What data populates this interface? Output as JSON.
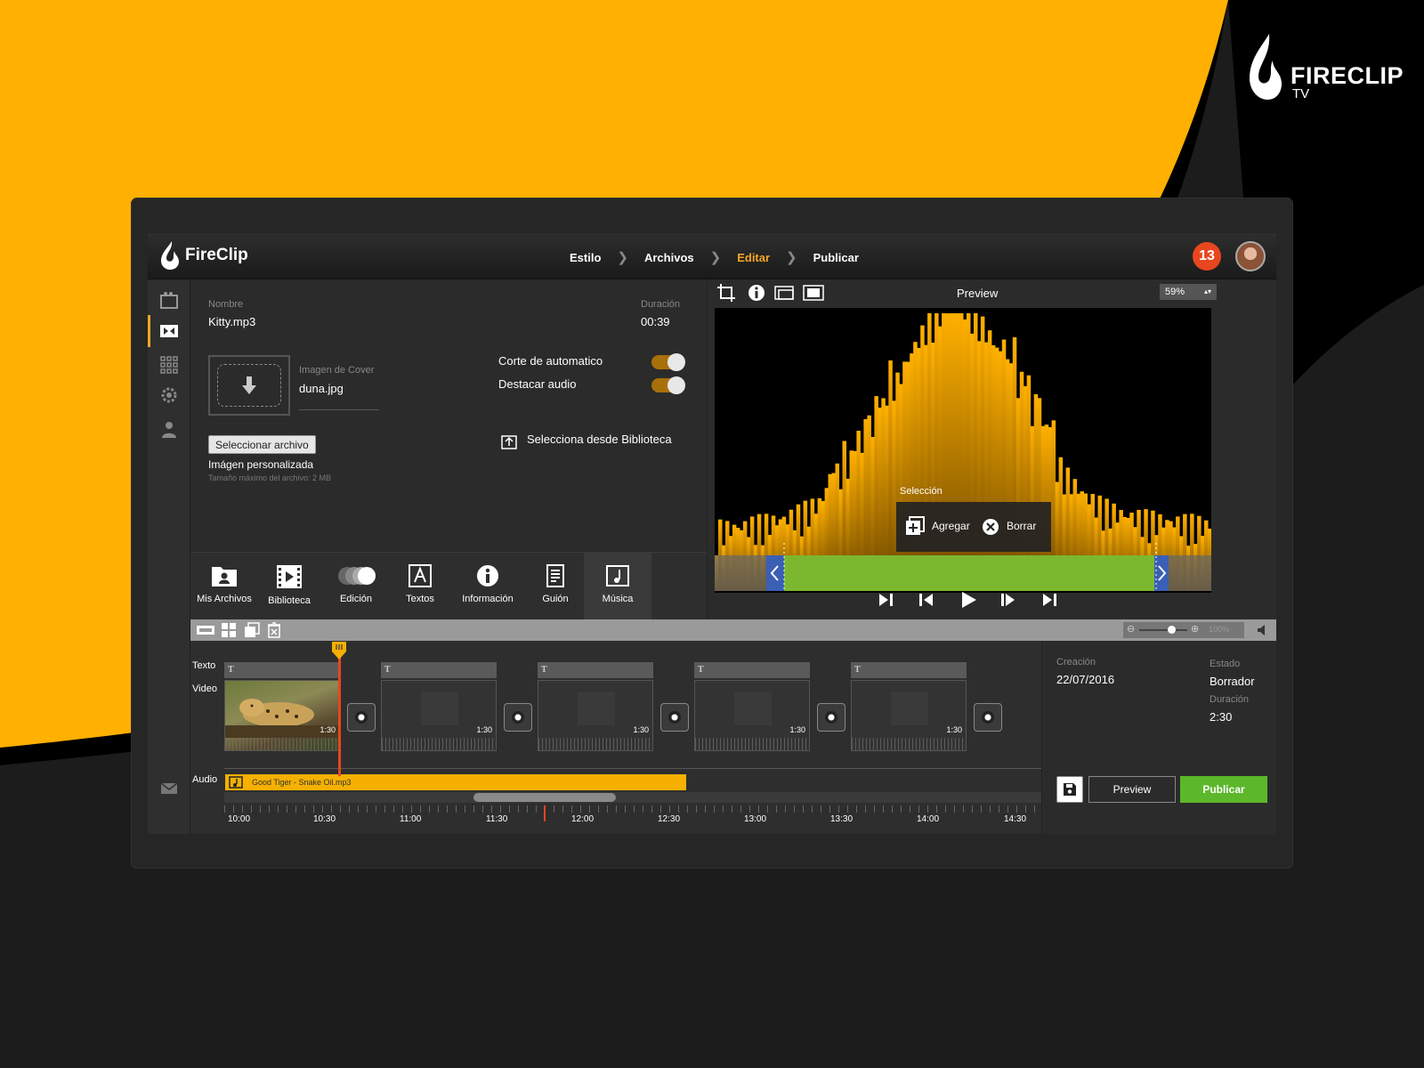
{
  "brand": {
    "name": "FIRECLIP",
    "sub": "TV"
  },
  "app": {
    "logo_text": "FireClip"
  },
  "steps": [
    {
      "label": "Estilo"
    },
    {
      "label": "Archivos"
    },
    {
      "label": "Editar"
    },
    {
      "label": "Publicar"
    }
  ],
  "header": {
    "channel_badge": "13"
  },
  "file": {
    "name_label": "Nombre",
    "name_value": "Kitty.mp3",
    "duration_label": "Duración",
    "duration_value": "00:39",
    "cover_label": "Imagen de Cover",
    "cover_value": "duna.jpg",
    "select_button": "Seleccionar archivo",
    "custom_image": "Imágen personalizada",
    "max_size": "Tamaño máximo del archivo: 2 MB",
    "toggle_auto": "Corte de automatico",
    "toggle_audio": "Destacar audio",
    "library_link": "Selecciona desde Biblioteca"
  },
  "tools": [
    {
      "label": "Mis Archivos"
    },
    {
      "label": "Biblioteca"
    },
    {
      "label": "Edición"
    },
    {
      "label": "Textos"
    },
    {
      "label": "Información"
    },
    {
      "label": "Guión"
    },
    {
      "label": "Música"
    }
  ],
  "preview": {
    "title": "Preview",
    "zoom": "59%",
    "selection_label": "Selección",
    "add_label": "Agregar",
    "delete_label": "Borrar"
  },
  "timeline": {
    "row_text": "Texto",
    "row_video": "Video",
    "row_audio": "Audio",
    "clip_duration": "1:30",
    "text_marker": "T",
    "audio_file": "Good Tiger - Snake Oil.mp3",
    "zoom_label": "100%",
    "ruler": [
      "10:00",
      "10:30",
      "11:00",
      "11:30",
      "12:00",
      "12:30",
      "13:00",
      "13:30",
      "14:00",
      "14:30"
    ]
  },
  "details": {
    "created_label": "Creación",
    "created_value": "22/07/2016",
    "status_label": "Estado",
    "status_value": "Borrador",
    "duration_label": "Duración",
    "duration_value": "2:30",
    "preview_button": "Preview",
    "publish_button": "Publicar"
  },
  "colors": {
    "accent": "#f5a623",
    "publish": "#5cb82a",
    "badge": "#e8461e",
    "selection": "#7cb82f"
  }
}
